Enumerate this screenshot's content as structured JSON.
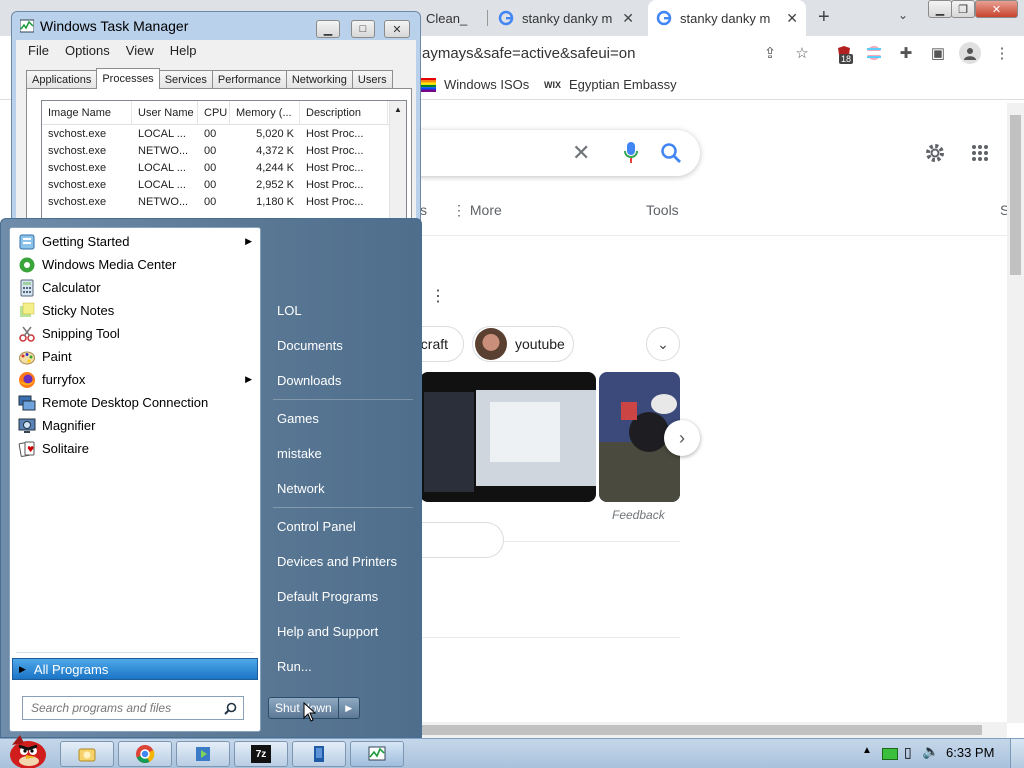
{
  "browser": {
    "tabs": [
      {
        "title": "Clean_",
        "active": false
      },
      {
        "title": "stanky danky m",
        "active": false
      },
      {
        "title": "stanky danky m",
        "active": true
      }
    ],
    "new_tab_symbol": "+",
    "tab_close_symbol": "✕",
    "address": "aymays&safe=active&safeui=on",
    "extension_badge": "18",
    "bookmarks": [
      "Windows ISOs",
      "Egyptian Embassy"
    ],
    "bookmark_wix_label": "WIX",
    "colors": {
      "tabbar": "#dee1e6",
      "google_blue": "#4285f4"
    }
  },
  "search_page": {
    "nav_more": "More",
    "nav_tools": "Tools",
    "nav_partial_left": "s",
    "nav_partial_right": "S",
    "chips": [
      "ecraft",
      "youtube"
    ],
    "feedback": "Feedback"
  },
  "task_manager": {
    "title": "Windows Task Manager",
    "menu": [
      "File",
      "Options",
      "View",
      "Help"
    ],
    "tabs": [
      "Applications",
      "Processes",
      "Services",
      "Performance",
      "Networking",
      "Users"
    ],
    "selected_tab": "Processes",
    "columns": [
      "Image Name",
      "User Name",
      "CPU",
      "Memory (...",
      "Description"
    ],
    "rows": [
      [
        "svchost.exe",
        "LOCAL ...",
        "00",
        "5,020 K",
        "Host Proc..."
      ],
      [
        "svchost.exe",
        "NETWO...",
        "00",
        "4,372 K",
        "Host Proc..."
      ],
      [
        "svchost.exe",
        "LOCAL ...",
        "00",
        "4,244 K",
        "Host Proc..."
      ],
      [
        "svchost.exe",
        "LOCAL ...",
        "00",
        "2,952 K",
        "Host Proc..."
      ],
      [
        "svchost.exe",
        "NETWO...",
        "00",
        "1,180 K",
        "Host Proc..."
      ]
    ]
  },
  "start_menu": {
    "programs": [
      {
        "label": "Getting Started",
        "icon": "getting-started-icon",
        "submenu": true
      },
      {
        "label": "Windows Media Center",
        "icon": "media-center-icon",
        "submenu": false
      },
      {
        "label": "Calculator",
        "icon": "calculator-icon",
        "submenu": false
      },
      {
        "label": "Sticky Notes",
        "icon": "sticky-notes-icon",
        "submenu": false
      },
      {
        "label": "Snipping Tool",
        "icon": "snipping-tool-icon",
        "submenu": false
      },
      {
        "label": "Paint",
        "icon": "paint-icon",
        "submenu": false
      },
      {
        "label": "furryfox",
        "icon": "firefox-icon",
        "submenu": true
      },
      {
        "label": "Remote Desktop Connection",
        "icon": "remote-desktop-icon",
        "submenu": false
      },
      {
        "label": "Magnifier",
        "icon": "magnifier-icon",
        "submenu": false
      },
      {
        "label": "Solitaire",
        "icon": "solitaire-icon",
        "submenu": false
      }
    ],
    "all_programs": "All Programs",
    "search_placeholder": "Search programs and files",
    "places": [
      "LOL",
      "Documents",
      "Downloads",
      "Games",
      "mistake",
      "Network",
      "Control Panel",
      "Devices and Printers",
      "Default Programs",
      "Help and Support",
      "Run..."
    ],
    "shutdown": "Shut down"
  },
  "taskbar": {
    "apps": [
      "explorer-icon",
      "chrome-icon",
      "media-icon",
      "7zip-icon",
      "notepad-icon",
      "task-manager-icon"
    ],
    "sevenzip_label": "7z",
    "clock": "6:33 PM"
  }
}
